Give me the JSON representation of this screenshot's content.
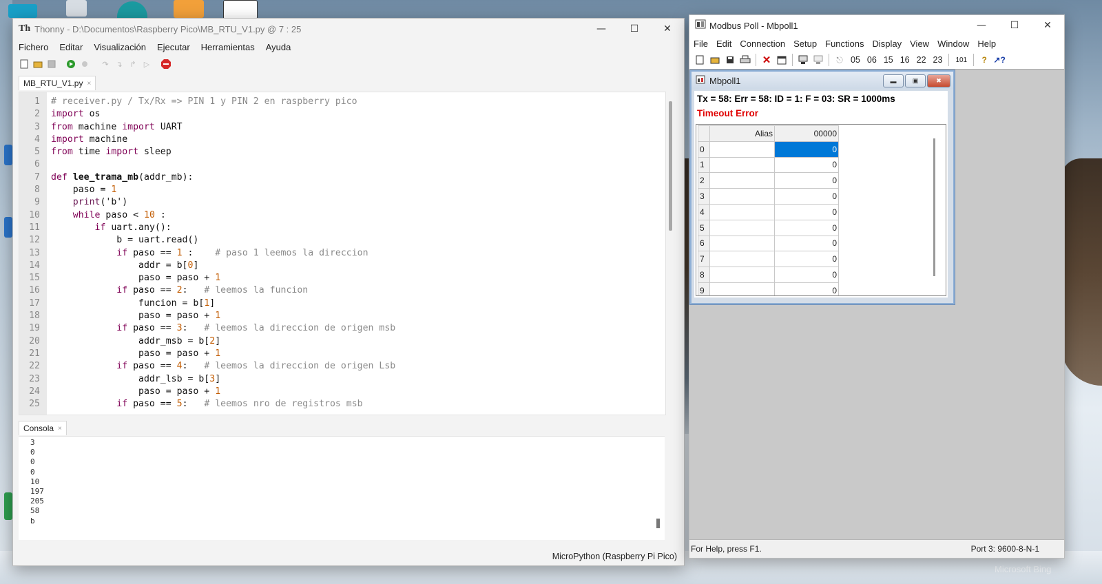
{
  "desktop": {
    "watermark": "Microsoft Bing"
  },
  "thonny": {
    "title": "Thonny  -  D:\\Documentos\\Raspberry Pico\\MB_RTU_V1.py  @  7 : 25",
    "logo": "Th",
    "menu": [
      "Fichero",
      "Editar",
      "Visualización",
      "Ejecutar",
      "Herramientas",
      "Ayuda"
    ],
    "tab_label": "MB_RTU_V1.py",
    "console_tab_label": "Consola",
    "console_lines": [
      "3",
      "0",
      "0",
      "0",
      "10",
      "197",
      "205",
      "58",
      "b"
    ],
    "status_text": "MicroPython (Raspberry Pi Pico)",
    "code_lines": [
      "# receiver.py / Tx/Rx => PIN 1 y PIN 2 en raspberry pico",
      "import os",
      "from machine import UART",
      "import machine",
      "from time import sleep",
      "",
      "def lee_trama_mb(addr_mb):",
      "    paso = 1",
      "    print('b')",
      "    while paso < 10 :",
      "        if uart.any():",
      "            b = uart.read()",
      "            if paso == 1 :    # paso 1 leemos la direccion",
      "                addr = b[0]",
      "                paso = paso + 1",
      "            if paso == 2:   # leemos la funcion",
      "                funcion = b[1]",
      "                paso = paso + 1",
      "            if paso == 3:   # leemos la direccion de origen msb",
      "                addr_msb = b[2]",
      "                paso = paso + 1",
      "            if paso == 4:   # leemos la direccion de origen Lsb",
      "                addr_lsb = b[3]",
      "                paso = paso + 1",
      "            if paso == 5:   # leemos nro de registros msb"
    ]
  },
  "modbus": {
    "title": "Modbus Poll - Mbpoll1",
    "menu": [
      "File",
      "Edit",
      "Connection",
      "Setup",
      "Functions",
      "Display",
      "View",
      "Window",
      "Help"
    ],
    "function_codes": [
      "05",
      "06",
      "15",
      "16",
      "22",
      "23"
    ],
    "binary_button": "101",
    "child_title": "Mbpoll1",
    "info_line": "Tx = 58: Err = 58: ID = 1: F = 03: SR = 1000ms",
    "error_line": "Timeout Error",
    "grid": {
      "col_alias": "Alias",
      "col_value": "00000",
      "rows": [
        {
          "index": "0",
          "alias": "",
          "value": "0"
        },
        {
          "index": "1",
          "alias": "",
          "value": "0"
        },
        {
          "index": "2",
          "alias": "",
          "value": "0"
        },
        {
          "index": "3",
          "alias": "",
          "value": "0"
        },
        {
          "index": "4",
          "alias": "",
          "value": "0"
        },
        {
          "index": "5",
          "alias": "",
          "value": "0"
        },
        {
          "index": "6",
          "alias": "",
          "value": "0"
        },
        {
          "index": "7",
          "alias": "",
          "value": "0"
        },
        {
          "index": "8",
          "alias": "",
          "value": "0"
        },
        {
          "index": "9",
          "alias": "",
          "value": "0"
        }
      ]
    },
    "status_left": "For Help, press F1.",
    "status_right": "Port 3: 9600-8-N-1"
  }
}
